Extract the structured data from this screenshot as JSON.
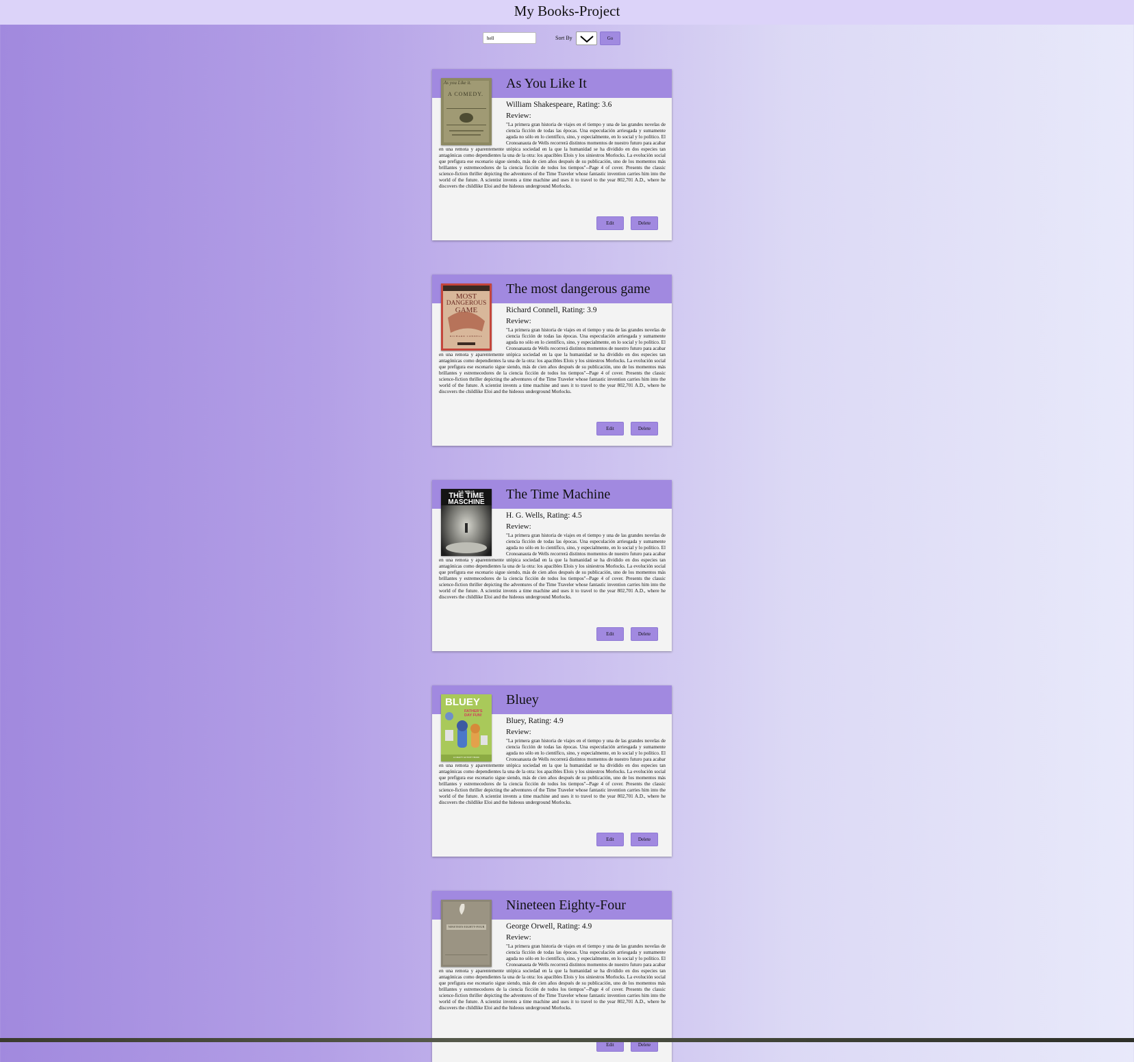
{
  "header": {
    "title": "My Books-Project"
  },
  "controls": {
    "search_value": "hell",
    "sort_label": "Sort By",
    "go_label": "Go"
  },
  "review_label": "Review:",
  "actions": {
    "edit": "Edit",
    "delete": "Delete"
  },
  "books": [
    {
      "title": "As You Like It",
      "meta": "William Shakespeare, Rating: 3.6",
      "review": "\"La primera gran historia de viajes en el tiempo y una de las grandes novelas de ciencia ficción de todas las épocas. Una especulación arriesgada y sumamente aguda no sólo en lo científico, sino, y especialmente, en lo social y lo político. El Cronoanauta de Wells recorrerá distintos momentos de nuestro futuro para acabar en una remota y aparentemente utópica sociedad en la que la humanidad se ha dividido en dos especies tan antagónicas como dependientes la una de la otra: los apacibles Elois y los siniestros Morlocks. La evolución social que prefigura ese escenario sigue siendo, más de cien años después de su publicación, uno de los momentos más brillantes y estremecedores de la ciencia ficción de todos los tiempos\"--Page 4 of cover. Presents the classic science-fiction thriller depicting the adventures of the Time Traveler whose fantastic invention carries him into the world of the future. A scientist invents a time machine and uses it to travel to the year 802,701 A.D., where he discovers the childlike Eloi and the hideous underground Morlocks."
    },
    {
      "title": "The most dangerous game",
      "meta": "Richard Connell, Rating: 3.9",
      "review": "\"La primera gran historia de viajes en el tiempo y una de las grandes novelas de ciencia ficción de todas las épocas. Una especulación arriesgada y sumamente aguda no sólo en lo científico, sino, y especialmente, en lo social y lo político. El Cronoanauta de Wells recorrerá distintos momentos de nuestro futuro para acabar en una remota y aparentemente utópica sociedad en la que la humanidad se ha dividido en dos especies tan antagónicas como dependientes la una de la otra: los apacibles Elois y los siniestros Morlocks. La evolución social que prefigura ese escenario sigue siendo, más de cien años después de su publicación, uno de los momentos más brillantes y estremecedores de la ciencia ficción de todos los tiempos\"--Page 4 of cover. Presents the classic science-fiction thriller depicting the adventures of the Time Traveler whose fantastic invention carries him into the world of the future. A scientist invents a time machine and uses it to travel to the year 802,701 A.D., where he discovers the childlike Eloi and the hideous underground Morlocks."
    },
    {
      "title": "The Time Machine",
      "meta": "H. G. Wells, Rating: 4.5",
      "review": "\"La primera gran historia de viajes en el tiempo y una de las grandes novelas de ciencia ficción de todas las épocas. Una especulación arriesgada y sumamente aguda no sólo en lo científico, sino, y especialmente, en lo social y lo político. El Cronoanauta de Wells recorrerá distintos momentos de nuestro futuro para acabar en una remota y aparentemente utópica sociedad en la que la humanidad se ha dividido en dos especies tan antagónicas como dependientes la una de la otra: los apacibles Elois y los siniestros Morlocks. La evolución social que prefigura ese escenario sigue siendo, más de cien años después de su publicación, uno de los momentos más brillantes y estremecedores de la ciencia ficción de todos los tiempos\"--Page 4 of cover. Presents the classic science-fiction thriller depicting the adventures of the Time Traveler whose fantastic invention carries him into the world of the future. A scientist invents a time machine and uses it to travel to the year 802,701 A.D., where he discovers the childlike Eloi and the hideous underground Morlocks."
    },
    {
      "title": "Bluey",
      "meta": "Bluey, Rating: 4.9",
      "review": "\"La primera gran historia de viajes en el tiempo y una de las grandes novelas de ciencia ficción de todas las épocas. Una especulación arriesgada y sumamente aguda no sólo en lo científico, sino, y especialmente, en lo social y lo político. El Cronoanauta de Wells recorrerá distintos momentos de nuestro futuro para acabar en una remota y aparentemente utópica sociedad en la que la humanidad se ha dividido en dos especies tan antagónicas como dependientes la una de la otra: los apacibles Elois y los siniestros Morlocks. La evolución social que prefigura ese escenario sigue siendo, más de cien años después de su publicación, uno de los momentos más brillantes y estremecedores de la ciencia ficción de todos los tiempos\"--Page 4 of cover. Presents the classic science-fiction thriller depicting the adventures of the Time Traveler whose fantastic invention carries him into the world of the future. A scientist invents a time machine and uses it to travel to the year 802,701 A.D., where he discovers the childlike Eloi and the hideous underground Morlocks."
    },
    {
      "title": "Nineteen Eighty-Four",
      "meta": "George Orwell, Rating: 4.9",
      "review": "\"La primera gran historia de viajes en el tiempo y una de las grandes novelas de ciencia ficción de todas las épocas. Una especulación arriesgada y sumamente aguda no sólo en lo científico, sino, y especialmente, en lo social y lo político. El Cronoanauta de Wells recorrerá distintos momentos de nuestro futuro para acabar en una remota y aparentemente utópica sociedad en la que la humanidad se ha dividido en dos especies tan antagónicas como dependientes la una de la otra: los apacibles Elois y los siniestros Morlocks. La evolución social que prefigura ese escenario sigue siendo, más de cien años después de su publicación, uno de los momentos más brillantes y estremecedores de la ciencia ficción de todos los tiempos\"--Page 4 of cover. Presents the classic science-fiction thriller depicting the adventures of the Time Traveler whose fantastic invention carries him into the world of the future. A scientist invents a time machine and uses it to travel to the year 802,701 A.D., where he discovers the childlike Eloi and the hideous underground Morlocks."
    }
  ],
  "covers": [
    {
      "lettering": [
        "As you Like it.",
        "A COMEDY."
      ]
    },
    {
      "lettering": [
        "MOST",
        "DANGEROUS",
        "GAME",
        "RICHARD CONNELL"
      ]
    },
    {
      "lettering": [
        "H.G. WELLS",
        "THE TIME",
        "MASCHINE"
      ]
    },
    {
      "lettering": [
        "BLUEY",
        "FATHER'S DAY FUN!",
        "A CRAFTY ACTIVITY BOOK"
      ]
    },
    {
      "lettering": [
        "NINETEEN EIGHTY-FOUR"
      ]
    }
  ],
  "colors": {
    "header_bg": "#dcd3f9",
    "accent": "#a189e0",
    "card_bg": "#f3f3f3"
  },
  "icons": {
    "sort_dropdown": "chevron-down-icon"
  }
}
